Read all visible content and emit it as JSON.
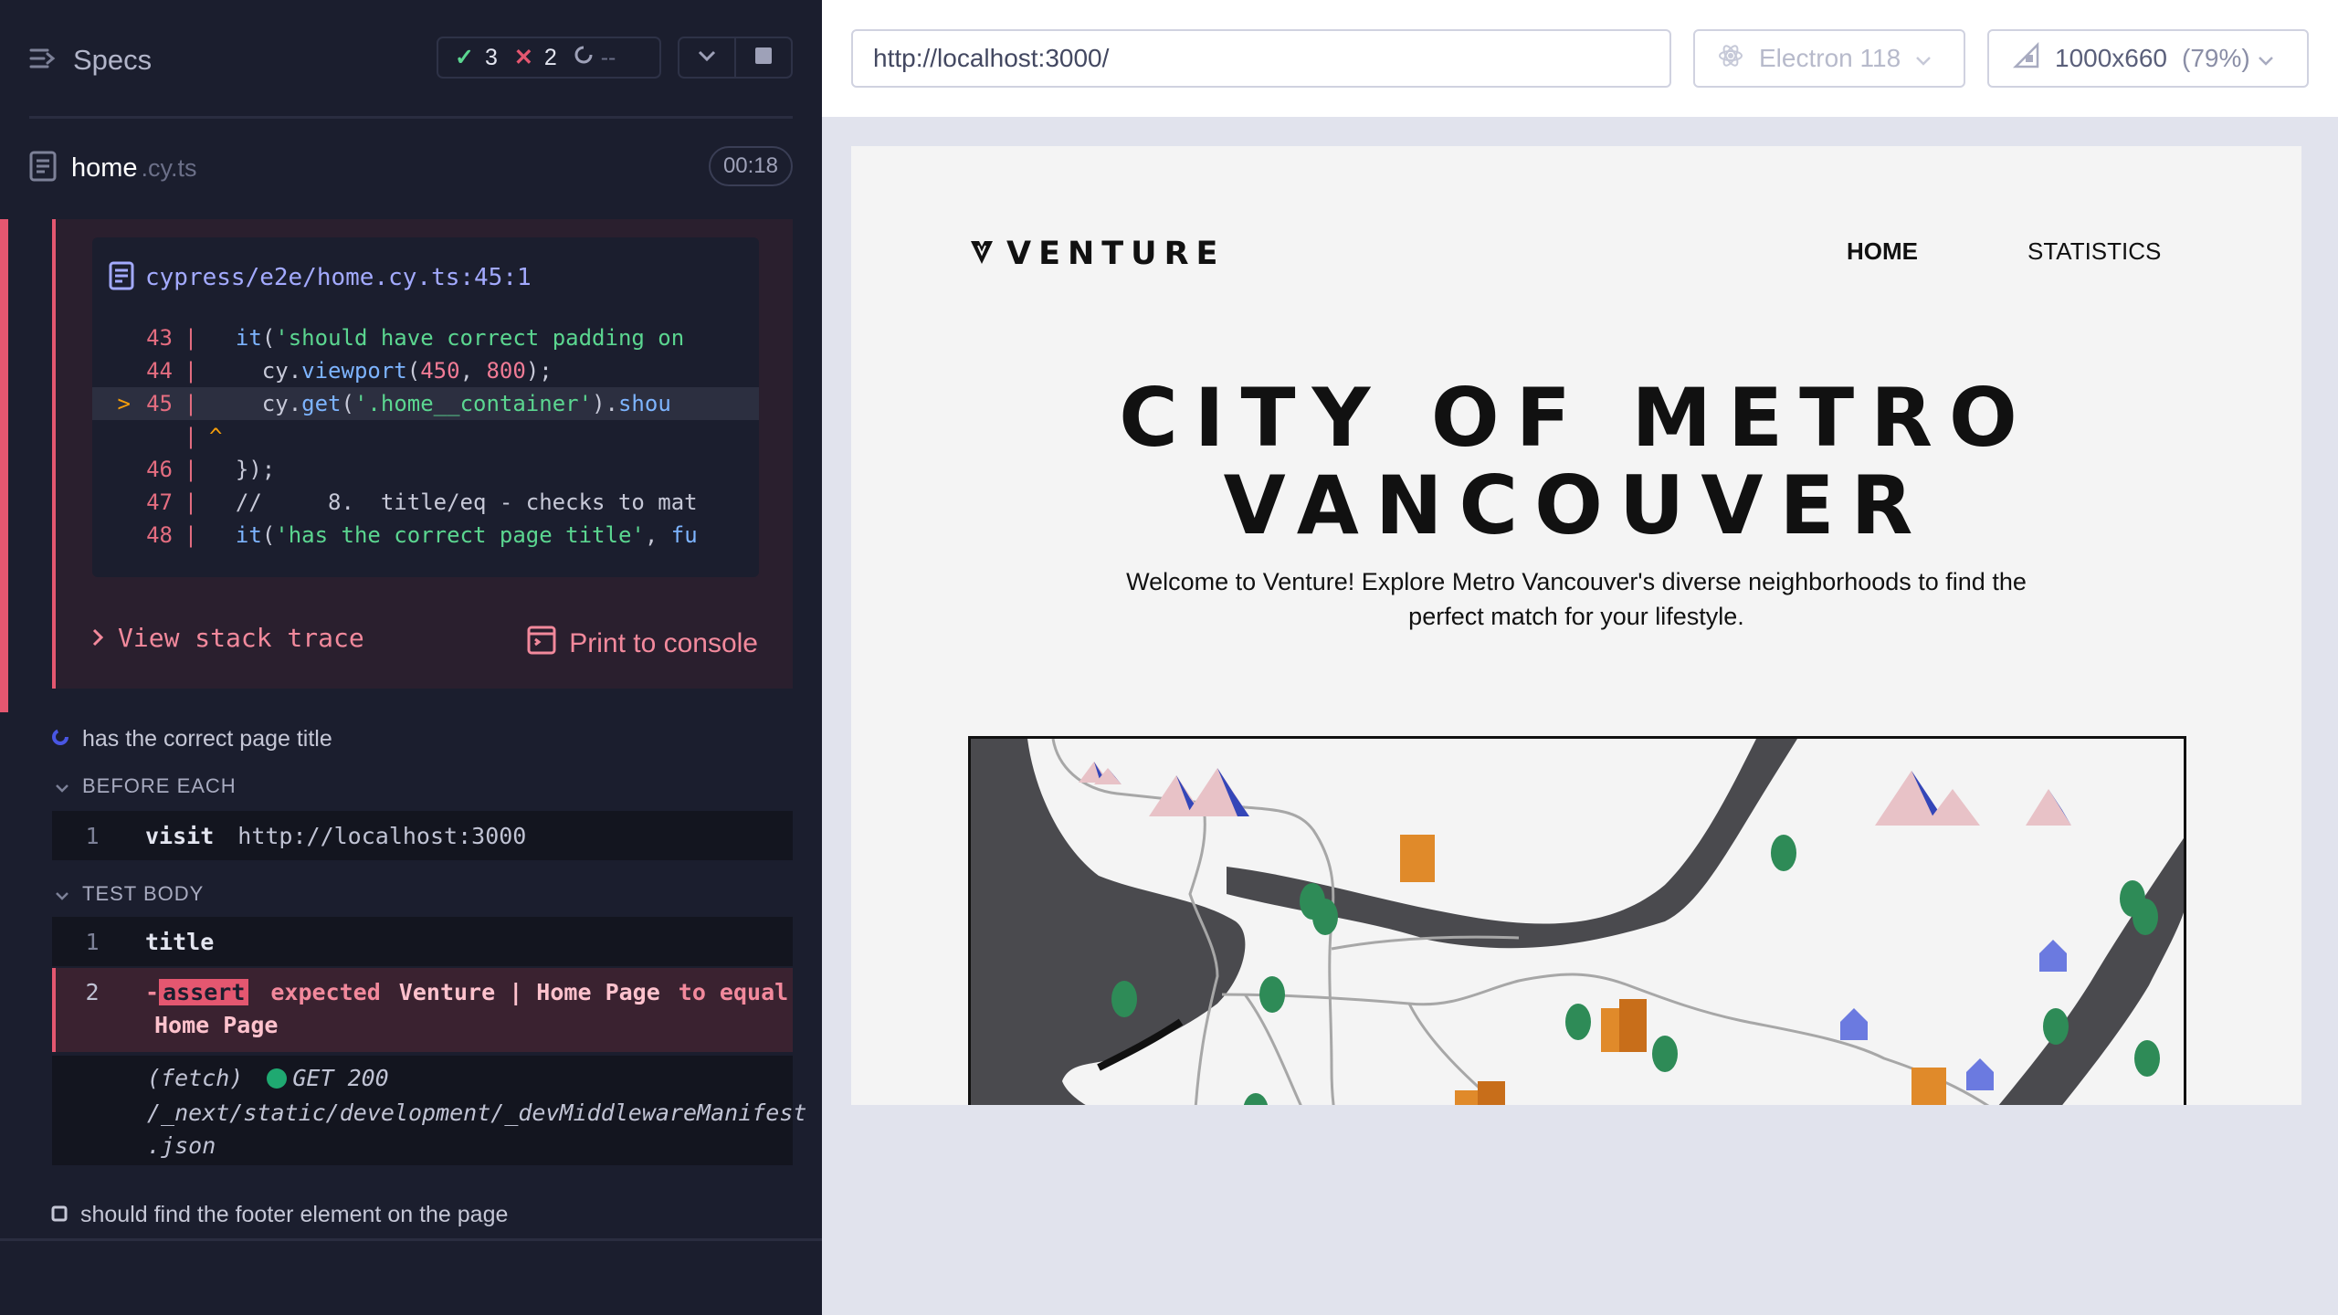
{
  "left": {
    "title": "Specs",
    "stats": {
      "passed": "3",
      "failed": "2",
      "pending": "--"
    },
    "file": {
      "name": "home",
      "ext": ".cy.ts",
      "duration": "00:18"
    },
    "error": {
      "location": "cypress/e2e/home.cy.ts:45:1",
      "view_stack": "View stack trace",
      "print_console": "Print to console",
      "code": [
        {
          "prefix": "",
          "num": "43",
          "text": "  it('should have correct padding on"
        },
        {
          "prefix": "",
          "num": "44",
          "text": "    cy.viewport(450, 800);"
        },
        {
          "prefix": ">",
          "num": "45",
          "text": "    cy.get('.home__container').shou"
        },
        {
          "prefix": "",
          "num": "",
          "text": "^"
        },
        {
          "prefix": "",
          "num": "46",
          "text": "  });"
        },
        {
          "prefix": "",
          "num": "47",
          "text": "  //     8.  title/eq - checks to mat"
        },
        {
          "prefix": "",
          "num": "48",
          "text": "  it('has the correct page title', fu"
        }
      ]
    },
    "current_test": "has the correct page title",
    "before_each": {
      "label": "BEFORE EACH",
      "commands": [
        {
          "num": "1",
          "name": "visit",
          "arg": "http://localhost:3000"
        }
      ]
    },
    "test_body": {
      "label": "TEST BODY",
      "title_cmd": {
        "num": "1",
        "name": "title"
      },
      "assert": {
        "num": "2",
        "dash": "-",
        "badge": "assert",
        "expected": "expected",
        "actual": "Venture | Home Page",
        "to_equal": "to equal",
        "target": "Home Page"
      },
      "fetch": {
        "label": "(fetch)",
        "method": "GET 200",
        "url_line1": "/_next/static/development/_devMiddlewareManifest",
        "url_line2": ".json"
      }
    },
    "next_test": "should find the footer element on the page"
  },
  "right": {
    "url": "http://localhost:3000/",
    "browser": "Electron 118",
    "viewport": "1000x660",
    "zoom": "(79%)",
    "app": {
      "logo": "VENTURE",
      "nav": [
        "HOME",
        "STATISTICS"
      ],
      "hero_line1": "CITY OF METRO",
      "hero_line2": "VANCOUVER",
      "subtitle": "Welcome to Venture! Explore Metro Vancouver's diverse neighborhoods to find the perfect match for your lifestyle."
    }
  },
  "colors": {
    "panel_bg": "#1b1e2e",
    "error_red": "#e45770",
    "pass_green": "#5bd690",
    "link_blue": "#a3aaff",
    "mountain_pink": "#e8c2c7",
    "mountain_blue": "#3446b8",
    "tree_green": "#2e8b57",
    "building_orange": "#e08a2a",
    "land_dark": "#4a4a4e"
  }
}
